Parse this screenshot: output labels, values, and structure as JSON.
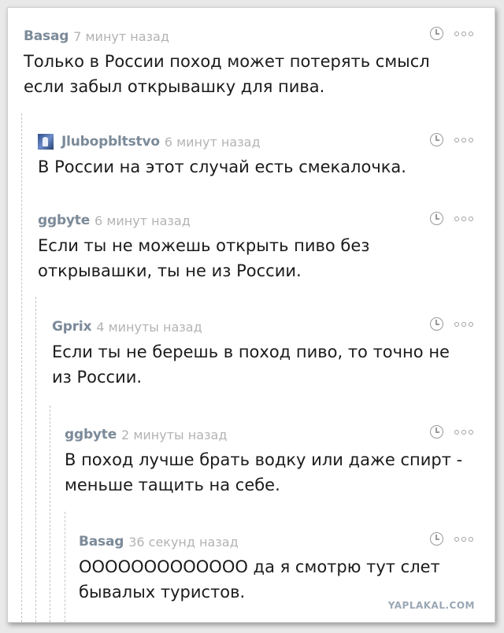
{
  "comments": [
    {
      "author": "Basag",
      "time": "7 минут назад",
      "text": "Только в России поход может потерять смысл если забыл открывашку для пива."
    },
    {
      "author": "Jlubopbltstvo",
      "time": "6 минут назад",
      "text": "В России на этот случай есть смекалочка."
    },
    {
      "author": "ggbyte",
      "time": "6 минут назад",
      "text": "Если ты не можешь открыть пиво без открывашки, ты не из России."
    },
    {
      "author": "Gprix",
      "time": "4 минуты назад",
      "text": "Если ты не берешь в поход пиво, то точно не из России."
    },
    {
      "author": "ggbyte",
      "time": "2 минуты назад",
      "text": "В поход лучше брать водку или даже спирт - меньше тащить на себе."
    },
    {
      "author": "Basag",
      "time": "36 секунд назад",
      "text": "ООООООООООООО да я смотрю тут слет бывалых туристов."
    }
  ],
  "watermark": "YAPLAKAL.COM",
  "icons": {
    "clock": "clock-icon",
    "more": "more-dots-icon",
    "avatar": "user-avatar"
  },
  "colors": {
    "author": "#7b8a99",
    "time": "#b3b3b3",
    "text": "#1b1b1b"
  }
}
